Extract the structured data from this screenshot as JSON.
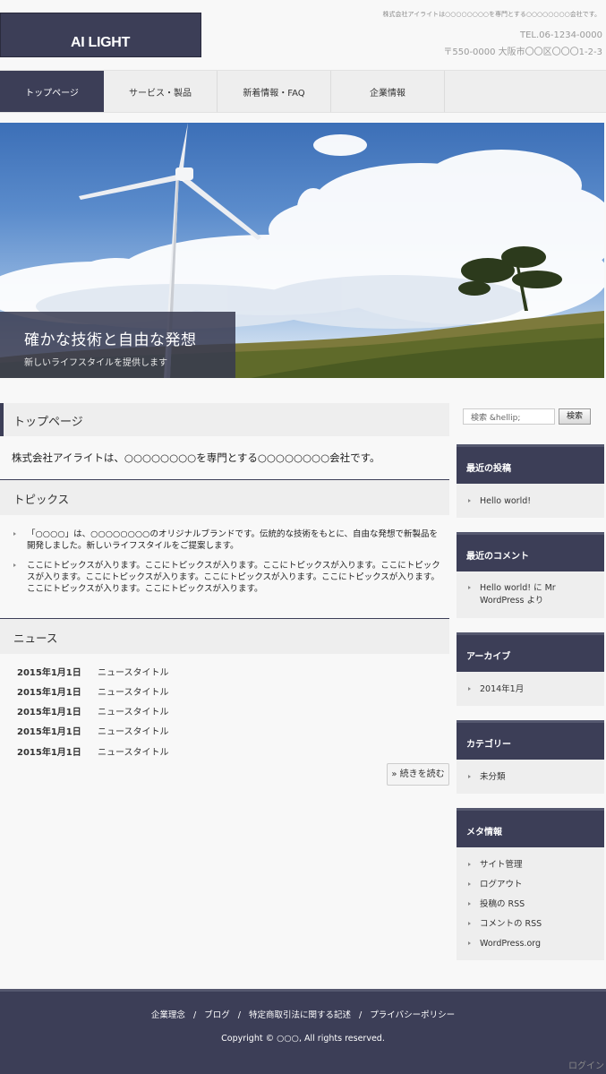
{
  "header": {
    "logo": "AI LIGHT",
    "tagline": "株式会社アイライトは○○○○○○○○を専門とする○○○○○○○○会社です。",
    "tel": "TEL.06-1234-0000",
    "address": "〒550-0000 大阪市〇〇区〇〇〇1-2-3"
  },
  "nav": {
    "items": [
      "トップページ",
      "サービス・製品",
      "新着情報・FAQ",
      "企業情報"
    ]
  },
  "hero": {
    "title": "確かな技術と自由な発想",
    "subtitle": "新しいライフスタイルを提供します"
  },
  "main": {
    "page_title": "トップページ",
    "intro": "株式会社アイライトは、○○○○○○○○を専門とする○○○○○○○○会社です。",
    "topics_heading": "トピックス",
    "topics": [
      "「○○○○」は、○○○○○○○○のオリジナルブランドです。伝統的な技術をもとに、自由な発想で新製品を開発しました。新しいライフスタイルをご提案します。",
      "ここにトピックスが入ります。ここにトピックスが入ります。ここにトピックスが入ります。ここにトピックスが入ります。ここにトピックスが入ります。ここにトピックスが入ります。ここにトピックスが入ります。ここにトピックスが入ります。ここにトピックスが入ります。"
    ],
    "news_heading": "ニュース",
    "news": [
      {
        "date": "2015年1月1日",
        "title": "ニュースタイトル"
      },
      {
        "date": "2015年1月1日",
        "title": "ニュースタイトル"
      },
      {
        "date": "2015年1月1日",
        "title": "ニュースタイトル"
      },
      {
        "date": "2015年1月1日",
        "title": "ニュースタイトル"
      },
      {
        "date": "2015年1月1日",
        "title": "ニュースタイトル"
      }
    ],
    "more_label": "» 続きを読む"
  },
  "sidebar": {
    "search_placeholder": "検索 &hellip;",
    "search_button": "検索",
    "widgets": [
      {
        "title": "最近の投稿",
        "items": [
          "Hello world!"
        ]
      },
      {
        "title": "最近のコメント",
        "items": [
          "Hello world! に Mr WordPress より"
        ]
      },
      {
        "title": "アーカイブ",
        "items": [
          "2014年1月"
        ]
      },
      {
        "title": "カテゴリー",
        "items": [
          "未分類"
        ]
      },
      {
        "title": "メタ情報",
        "items": [
          "サイト管理",
          "ログアウト",
          "投稿の RSS",
          "コメントの RSS",
          "WordPress.org"
        ]
      }
    ]
  },
  "footer": {
    "links": [
      "企業理念",
      "ブログ",
      "特定商取引法に関する記述",
      "プライバシーポリシー"
    ],
    "separator": "/",
    "copyright": "Copyright © ○○○, All rights reserved.",
    "login": "ログイン"
  },
  "colors": {
    "accent": "#3c3e57",
    "panel": "#eeeeee",
    "background": "#f8f8f8"
  }
}
